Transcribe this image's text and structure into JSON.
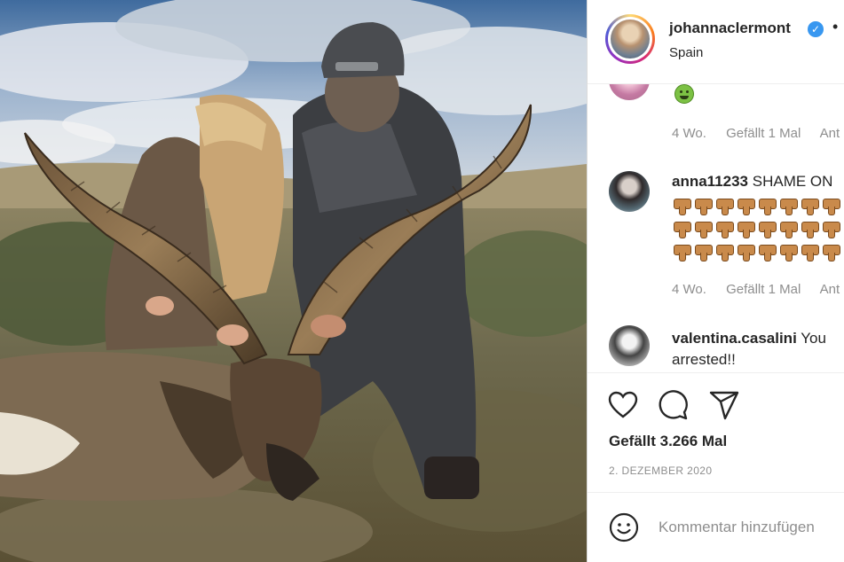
{
  "post": {
    "username": "johannaclermont",
    "separator": "•",
    "location": "Spain"
  },
  "comments": [
    {
      "meta": {
        "time": "4 Wo.",
        "likes": "Gefällt 1 Mal",
        "reply": "Ant"
      },
      "emoji": "sick-face-emoji"
    },
    {
      "username": "anna11233",
      "text": "SHAME ON",
      "emoji": "thumbs-down-emoji",
      "meta": {
        "time": "4 Wo.",
        "likes": "Gefällt 1 Mal",
        "reply": "Ant"
      }
    },
    {
      "username": "valentina.casalini",
      "text": "You",
      "text2": "arrested!!"
    }
  ],
  "actions": {
    "likes": "Gefällt 3.266 Mal",
    "date": "2. DEZEMBER 2020"
  },
  "comment_box": {
    "placeholder": "Kommentar hinzufügen"
  },
  "icons": [
    "heart-icon",
    "comment-icon",
    "share-icon",
    "smile-icon",
    "verified-badge-icon"
  ],
  "colors": {
    "verified": "#3897f0",
    "text": "#262626",
    "muted": "#8e8e8e",
    "border": "#efefef"
  }
}
